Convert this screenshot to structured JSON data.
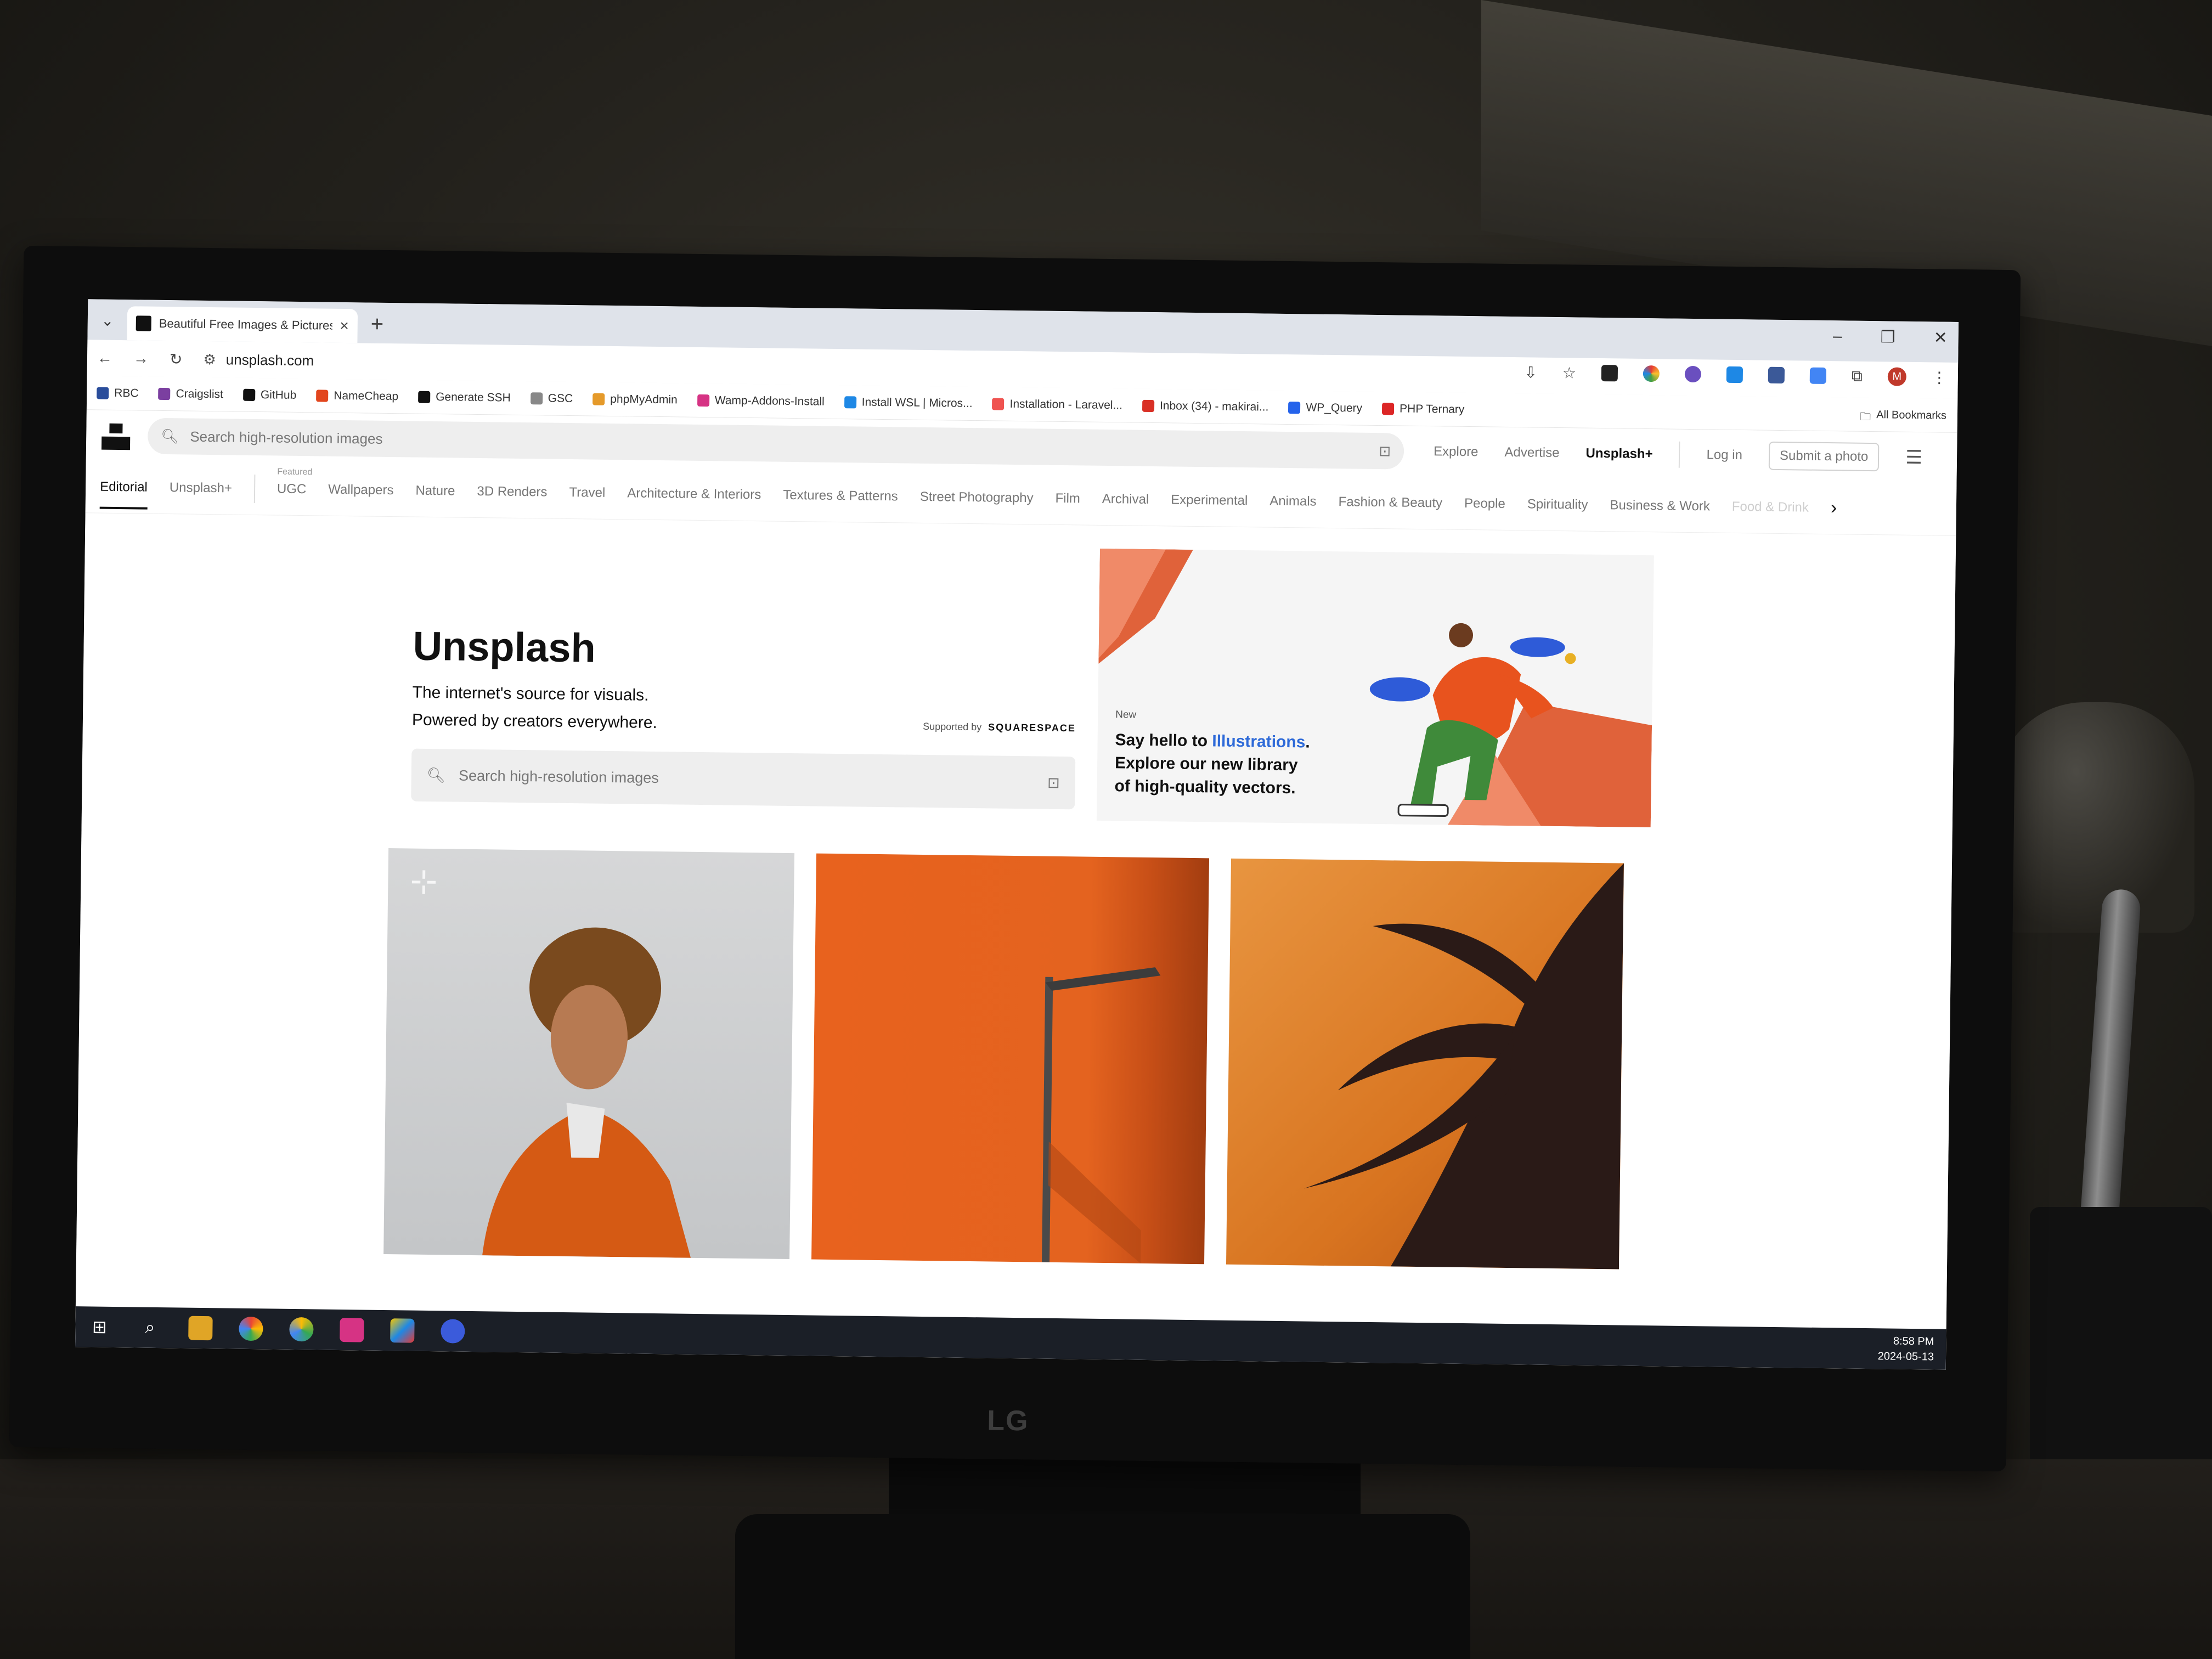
{
  "browser": {
    "tab_title": "Beautiful Free Images & Pictures",
    "url": "unsplash.com",
    "bookmarks": [
      {
        "label": "RBC",
        "color": "#2a4d9b"
      },
      {
        "label": "Craigslist",
        "color": "#7b3fa0"
      },
      {
        "label": "GitHub",
        "color": "#111111"
      },
      {
        "label": "NameCheap",
        "color": "#e2461e"
      },
      {
        "label": "Generate SSH",
        "color": "#111111"
      },
      {
        "label": "GSC",
        "color": "#888888"
      },
      {
        "label": "phpMyAdmin",
        "color": "#e59a2a"
      },
      {
        "label": "Wamp-Addons-Install",
        "color": "#d63384"
      },
      {
        "label": "Install WSL | Micros...",
        "color": "#1e88e5"
      },
      {
        "label": "Installation - Laravel...",
        "color": "#ef5350"
      },
      {
        "label": "Inbox (34) - makirai...",
        "color": "#d93025"
      },
      {
        "label": "WP_Query",
        "color": "#2563eb"
      },
      {
        "label": "PHP Ternary",
        "color": "#dc2626"
      }
    ],
    "all_bookmarks": "All Bookmarks",
    "profile_initial": "M"
  },
  "unsplash": {
    "search_placeholder": "Search high-resolution images",
    "nav": {
      "explore": "Explore",
      "advertise": "Advertise",
      "plus": "Unsplash+",
      "login": "Log in",
      "submit": "Submit a photo"
    },
    "categories": {
      "editorial": "Editorial",
      "plus": "Unsplash+",
      "featured_caption": "Featured",
      "ugc": "UGC",
      "items": [
        "Wallpapers",
        "Nature",
        "3D Renders",
        "Travel",
        "Architecture & Interiors",
        "Textures & Patterns",
        "Street Photography",
        "Film",
        "Archival",
        "Experimental",
        "Animals",
        "Fashion & Beauty",
        "People",
        "Spirituality",
        "Business & Work"
      ],
      "faded": "Food & Drink"
    },
    "hero": {
      "title": "Unsplash",
      "line1": "The internet's source for visuals.",
      "line2": "Powered by creators everywhere.",
      "supported_by": "Supported by",
      "sponsor": "SQUARESPACE",
      "search_placeholder": "Search high-resolution images"
    },
    "promo": {
      "badge": "New",
      "line1_prefix": "Say hello to ",
      "line1_link": "Illustrations",
      "line1_suffix": ".",
      "line2": "Explore our new library",
      "line3": "of high-quality vectors."
    }
  },
  "taskbar": {
    "time": "8:58 PM",
    "date": "2024-05-13"
  },
  "monitor": {
    "brand": "LG"
  }
}
